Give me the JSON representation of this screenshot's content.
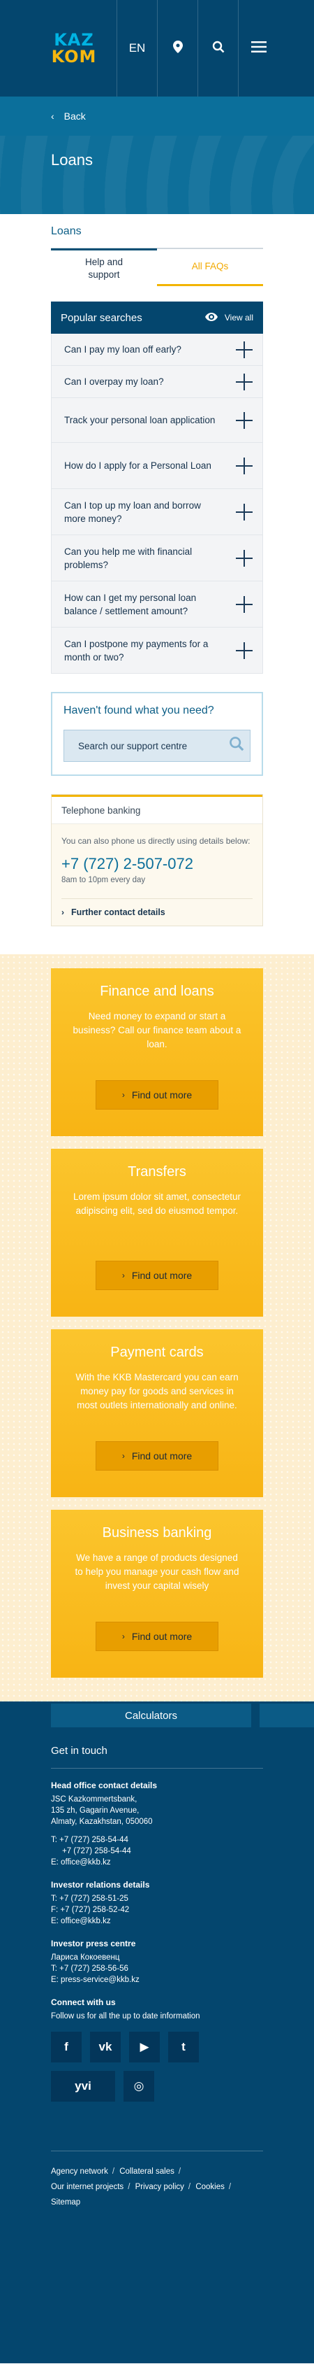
{
  "header": {
    "logo_line1": "KAZ",
    "logo_line2": "KOM",
    "language": "EN",
    "location_icon": "map-pin-icon",
    "search_icon": "search-icon",
    "menu_icon": "hamburger-menu-icon"
  },
  "nav": {
    "back_label": "Back"
  },
  "page": {
    "title": "Loans"
  },
  "section": {
    "title": "Loans",
    "tabs": [
      {
        "label": "Help and support",
        "active": true
      },
      {
        "label": "All FAQs",
        "active": false
      }
    ]
  },
  "faq": {
    "title": "Popular searches",
    "view_all": "View all",
    "items": [
      "Can I pay my loan off early?",
      "Can I overpay my loan?",
      "Track your personal loan application",
      "How do I apply for a Personal Loan",
      "Can I top up my loan and borrow more money?",
      "Can you help me with financial problems?",
      "How can I get my personal loan balance / settlement amount?",
      "Can I postpone my payments for a month or two?"
    ]
  },
  "support": {
    "title": "Haven't found what you need?",
    "search_placeholder": "Search our support centre"
  },
  "telephone": {
    "title": "Telephone banking",
    "note": "You can also phone us directly using details below:",
    "number": "+7 (727) 2-507-072",
    "hours": "8am to 10pm every day",
    "more": "Further contact details"
  },
  "promos": [
    {
      "title": "Finance and loans",
      "text": "Need money to expand or start a business? Call our finance team about a loan.",
      "button": "Find out more"
    },
    {
      "title": "Transfers",
      "text": "Lorem ipsum dolor sit amet, consectetur adipiscing elit, sed do eiusmod tempor.",
      "button": "Find out more"
    },
    {
      "title": "Payment cards",
      "text": "With the KKB Mastercard you can earn money pay for goods and services in most outlets internationally and online.",
      "button": "Find out more"
    },
    {
      "title": "Business banking",
      "text": "We have a range of products designed to help you manage your cash flow and invest your capital wisely",
      "button": "Find out more"
    }
  ],
  "calculators": {
    "label": "Calculators"
  },
  "footer": {
    "title": "Get in touch",
    "head_office": {
      "title": "Head office contact details",
      "lines": [
        "JSC Kazkommertsbank,",
        "135 zh, Gagarin Avenue,",
        "Almaty, Kazakhstan, 050060"
      ],
      "phones": [
        "T: +7 (727) 258-54-44",
        "     +7 (727) 258-54-44",
        "E: office@kkb.kz"
      ]
    },
    "investor": {
      "title": "Investor relations details",
      "lines": [
        "T: +7 (727) 258-51-25",
        "F: +7 (727) 258-52-42",
        "E: office@kkb.kz"
      ]
    },
    "press": {
      "title": "Investor press centre",
      "lines": [
        "Лариса Кокоевенц",
        "T: +7 (727) 258-56-56",
        "E: press-service@kkb.kz"
      ]
    },
    "connect": {
      "title": "Connect with us",
      "text": "Follow us for all the up to date information"
    },
    "social": [
      {
        "icon": "facebook-icon",
        "glyph": "f"
      },
      {
        "icon": "vk-icon",
        "glyph": "vk"
      },
      {
        "icon": "youtube-icon",
        "glyph": "▶"
      },
      {
        "icon": "twitter-icon",
        "glyph": "t"
      },
      {
        "icon": "yvi-icon",
        "glyph": "yvi"
      },
      {
        "icon": "instagram-icon",
        "glyph": "◎"
      }
    ],
    "links": [
      "Agency network",
      "Collateral sales",
      "Our internet projects",
      "Privacy policy",
      "Cookies",
      "Sitemap"
    ]
  }
}
